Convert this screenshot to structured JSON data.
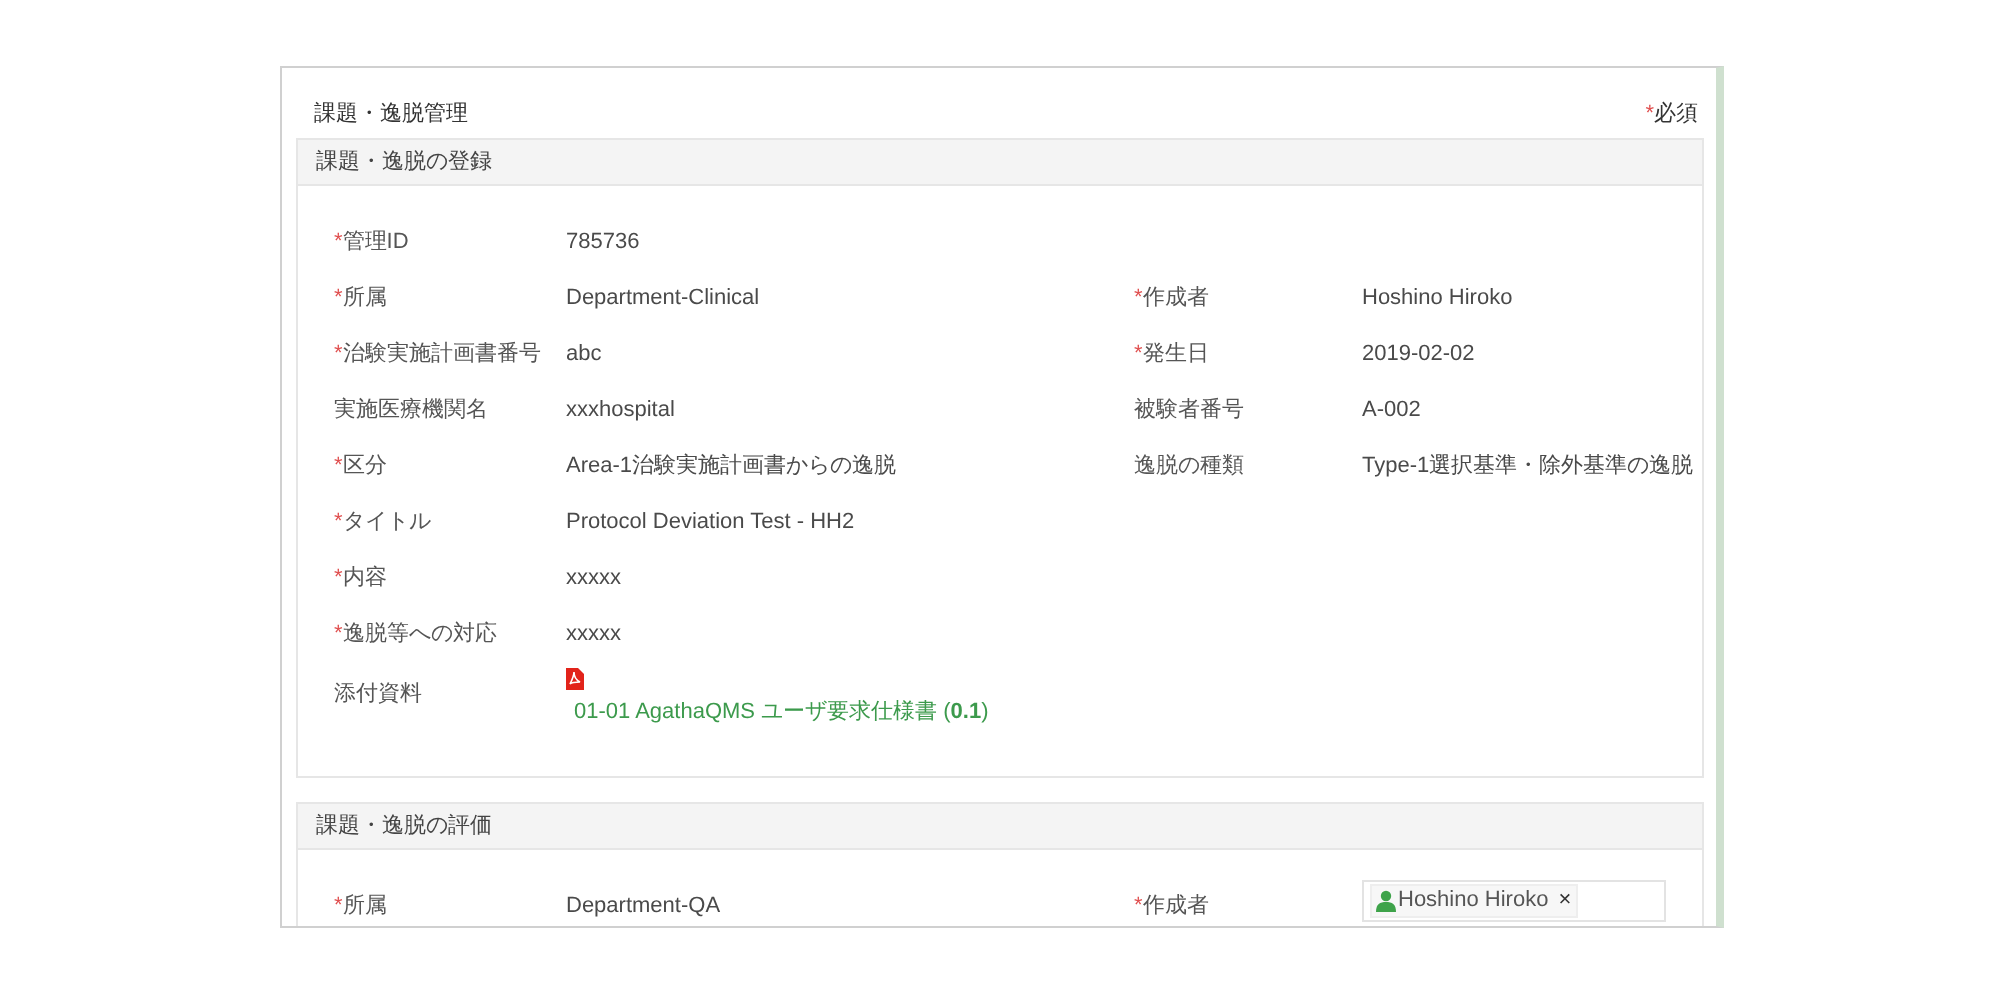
{
  "page_title": "課題・逸脱管理",
  "required_mark": "*",
  "required_legend": "必須",
  "sections": [
    {
      "title": "課題・逸脱の登録",
      "rows": [
        {
          "left": {
            "label": "管理ID",
            "required": true,
            "kind": "text",
            "value": "785736"
          }
        },
        {
          "left": {
            "label": "所属",
            "required": true,
            "kind": "text",
            "value": "Department-Clinical"
          },
          "right": {
            "label": "作成者",
            "required": true,
            "kind": "text",
            "value": "Hoshino Hiroko"
          }
        },
        {
          "left": {
            "label": "治験実施計画書番号",
            "required": true,
            "kind": "text",
            "value": "abc"
          },
          "right": {
            "label": "発生日",
            "required": true,
            "kind": "text",
            "value": "2019-02-02"
          }
        },
        {
          "left": {
            "label": "実施医療機関名",
            "required": false,
            "kind": "text",
            "value": "xxxhospital"
          },
          "right": {
            "label": "被験者番号",
            "required": false,
            "kind": "text",
            "value": "A-002"
          }
        },
        {
          "left": {
            "label": "区分",
            "required": true,
            "kind": "text",
            "value": "Area-1治験実施計画書からの逸脱"
          },
          "right": {
            "label": "逸脱の種類",
            "required": false,
            "kind": "text",
            "value": "Type-1選択基準・除外基準の逸脱"
          }
        },
        {
          "left": {
            "label": "タイトル",
            "required": true,
            "kind": "text",
            "value": "Protocol Deviation Test - HH2"
          }
        },
        {
          "left": {
            "label": "内容",
            "required": true,
            "kind": "text",
            "value": "xxxxx"
          }
        },
        {
          "left": {
            "label": "逸脱等への対応",
            "required": true,
            "kind": "text",
            "value": "xxxxx"
          }
        },
        {
          "left": {
            "label": "添付資料",
            "required": false,
            "kind": "attachment",
            "value": "01-01 AgathaQMS ユーザ要求仕様書 (**0.1**)"
          }
        }
      ]
    },
    {
      "title": "課題・逸脱の評価",
      "rows": [
        {
          "left": {
            "label": "所属",
            "required": true,
            "kind": "text",
            "value": "Department-QA"
          },
          "right": {
            "label": "作成者",
            "required": true,
            "kind": "user_chip",
            "value": "Hoshino Hiroko",
            "remove": "×"
          }
        }
      ]
    }
  ]
}
